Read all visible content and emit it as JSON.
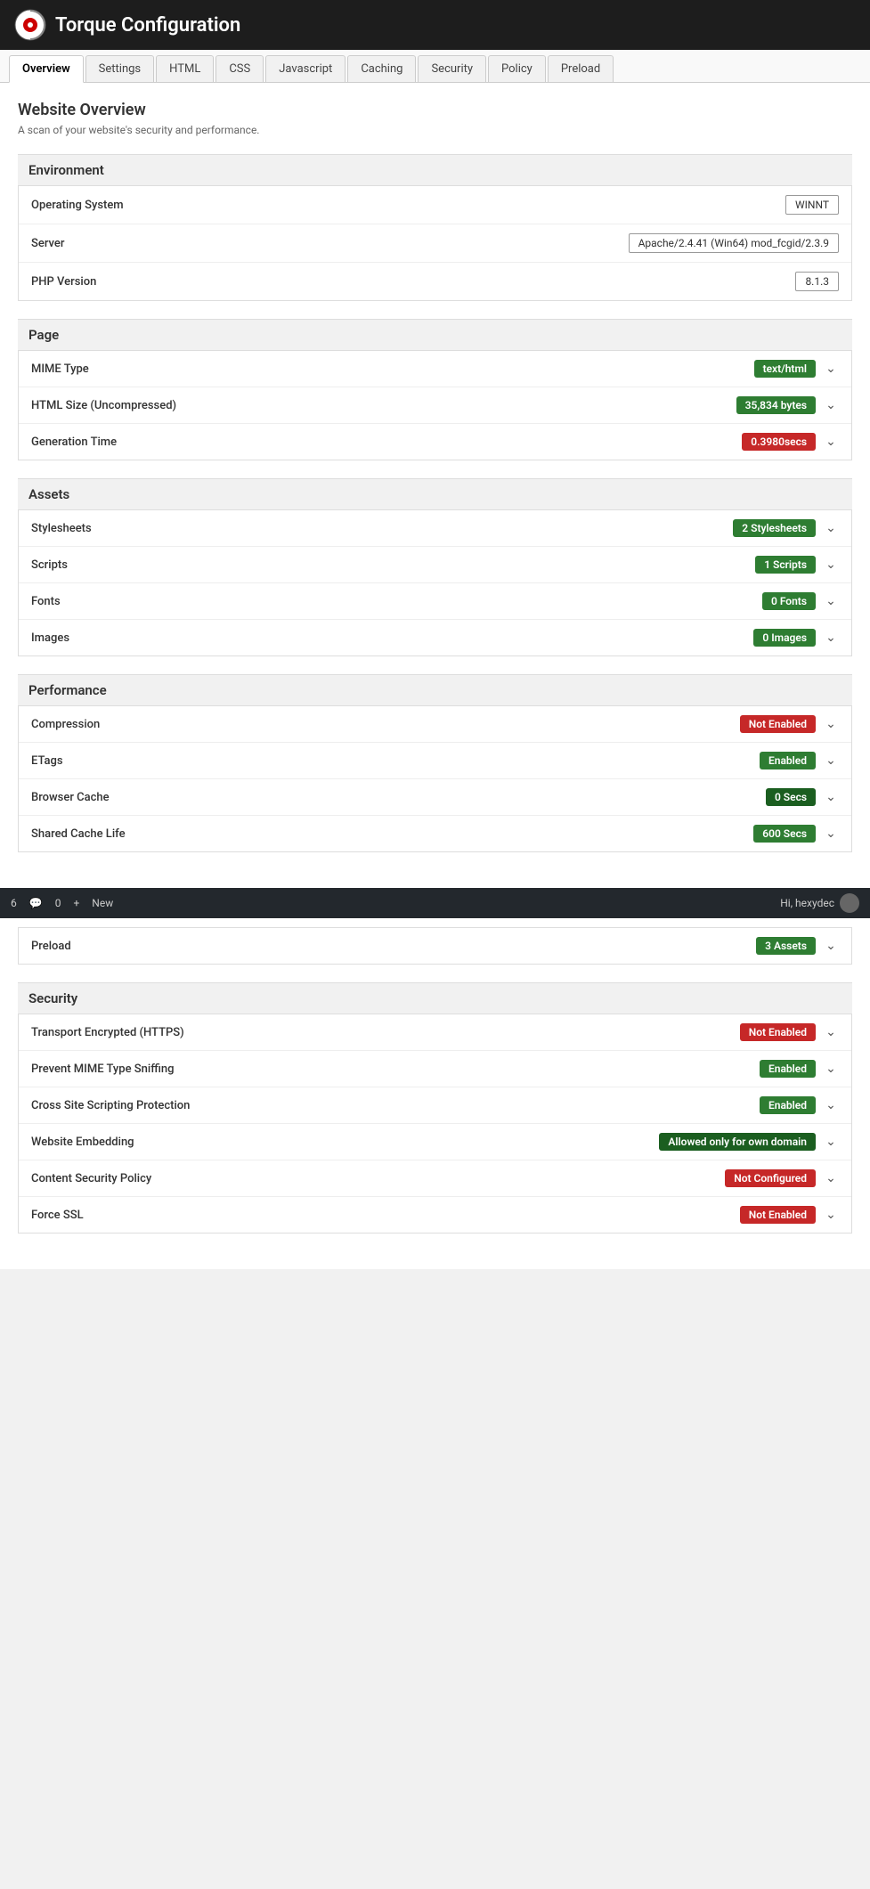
{
  "header": {
    "title": "Torque Configuration"
  },
  "tabs": [
    {
      "label": "Overview",
      "active": true
    },
    {
      "label": "Settings",
      "active": false
    },
    {
      "label": "HTML",
      "active": false
    },
    {
      "label": "CSS",
      "active": false
    },
    {
      "label": "Javascript",
      "active": false
    },
    {
      "label": "Caching",
      "active": false
    },
    {
      "label": "Security",
      "active": false
    },
    {
      "label": "Policy",
      "active": false
    },
    {
      "label": "Preload",
      "active": false
    }
  ],
  "page": {
    "heading": "Website Overview",
    "subtext": "A scan of your website's security and performance."
  },
  "sections": {
    "environment": {
      "heading": "Environment",
      "rows": [
        {
          "label": "Operating System",
          "value": "WINNT",
          "badge_type": "plain"
        },
        {
          "label": "Server",
          "value": "Apache/2.4.41 (Win64) mod_fcgid/2.3.9",
          "badge_type": "plain"
        },
        {
          "label": "PHP Version",
          "value": "8.1.3",
          "badge_type": "plain"
        }
      ]
    },
    "page_section": {
      "heading": "Page",
      "rows": [
        {
          "label": "MIME Type",
          "value": "text/html",
          "badge_type": "green",
          "has_chevron": true
        },
        {
          "label": "HTML Size (Uncompressed)",
          "value": "35,834 bytes",
          "badge_type": "green",
          "has_chevron": true
        },
        {
          "label": "Generation Time",
          "value": "0.3980secs",
          "badge_type": "red",
          "has_chevron": true
        }
      ]
    },
    "assets": {
      "heading": "Assets",
      "rows": [
        {
          "label": "Stylesheets",
          "value": "2 Stylesheets",
          "badge_type": "green",
          "has_chevron": true
        },
        {
          "label": "Scripts",
          "value": "1 Scripts",
          "badge_type": "green",
          "has_chevron": true
        },
        {
          "label": "Fonts",
          "value": "0 Fonts",
          "badge_type": "green",
          "has_chevron": true
        },
        {
          "label": "Images",
          "value": "0 Images",
          "badge_type": "green",
          "has_chevron": true
        }
      ]
    },
    "performance": {
      "heading": "Performance",
      "rows": [
        {
          "label": "Compression",
          "value": "Not Enabled",
          "badge_type": "red",
          "has_chevron": true
        },
        {
          "label": "ETags",
          "value": "Enabled",
          "badge_type": "green",
          "has_chevron": true
        },
        {
          "label": "Browser Cache",
          "value": "0 Secs",
          "badge_type": "dark-green",
          "has_chevron": true
        },
        {
          "label": "Shared Cache Life",
          "value": "600 Secs",
          "badge_type": "green",
          "has_chevron": true
        },
        {
          "label": "Preload",
          "value": "3 Assets",
          "badge_type": "green",
          "has_chevron": true
        }
      ]
    },
    "security": {
      "heading": "Security",
      "rows": [
        {
          "label": "Transport Encrypted (HTTPS)",
          "value": "Not Enabled",
          "badge_type": "red",
          "has_chevron": true
        },
        {
          "label": "Prevent MIME Type Sniffing",
          "value": "Enabled",
          "badge_type": "green",
          "has_chevron": true
        },
        {
          "label": "Cross Site Scripting Protection",
          "value": "Enabled",
          "badge_type": "green",
          "has_chevron": true
        },
        {
          "label": "Website Embedding",
          "value": "Allowed only for own domain",
          "badge_type": "dark-green",
          "has_chevron": true
        },
        {
          "label": "Content Security Policy",
          "value": "Not Configured",
          "badge_type": "red",
          "has_chevron": true
        },
        {
          "label": "Force SSL",
          "value": "Not Enabled",
          "badge_type": "red",
          "has_chevron": true
        }
      ]
    }
  },
  "admin_bar": {
    "site_number": "6",
    "comments": "0",
    "new_label": "New",
    "greeting": "Hi, hexydec"
  },
  "icons": {
    "chevron_down": "&#8964;",
    "comment": "&#128172;"
  }
}
